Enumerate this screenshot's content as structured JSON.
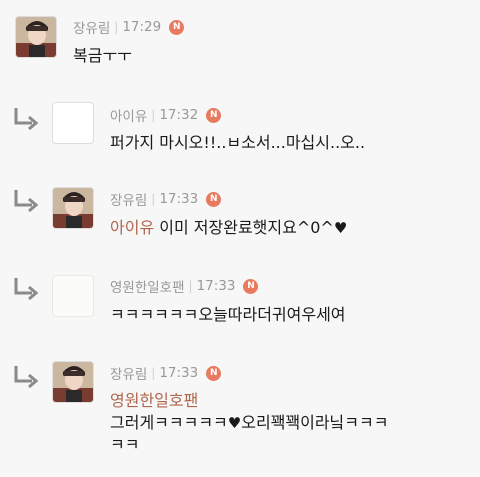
{
  "comments": [
    {
      "author": "장유림",
      "time": "17:29",
      "badge": "N",
      "text": "복금ㅜㅜ",
      "avatar": "photo",
      "reply": false
    },
    {
      "author": "아이유",
      "time": "17:32",
      "badge": "N",
      "text": "퍼가지 마시오!!..ㅂ소서...마십시..오..",
      "avatar": "blank",
      "reply": true
    },
    {
      "author": "장유림",
      "time": "17:33",
      "badge": "N",
      "mention": "아이유",
      "text": " 이미 저장완료햇지요^0^",
      "heart": "♥",
      "avatar": "photo",
      "reply": true
    },
    {
      "author": "영원한일호팬",
      "time": "17:33",
      "badge": "N",
      "text": "ㅋㅋㅋㅋㅋㅋ오늘따라더귀여우세여",
      "avatar": "pale",
      "reply": true
    },
    {
      "author": "장유림",
      "time": "17:33",
      "badge": "N",
      "mention": "영원한일호팬",
      "text_before_heart": "그러게ㅋㅋㅋㅋㅋ",
      "heart": "♥",
      "text_after_heart": "오리꽥꽥이라닠ㅋㅋㅋ",
      "text_line2": "ㅋㅋ",
      "avatar": "photo",
      "reply": true
    }
  ],
  "colors": {
    "badge": "#e87a5f",
    "mention": "#b0664e",
    "meta": "#999999",
    "arrow": "#8a8a8a"
  }
}
